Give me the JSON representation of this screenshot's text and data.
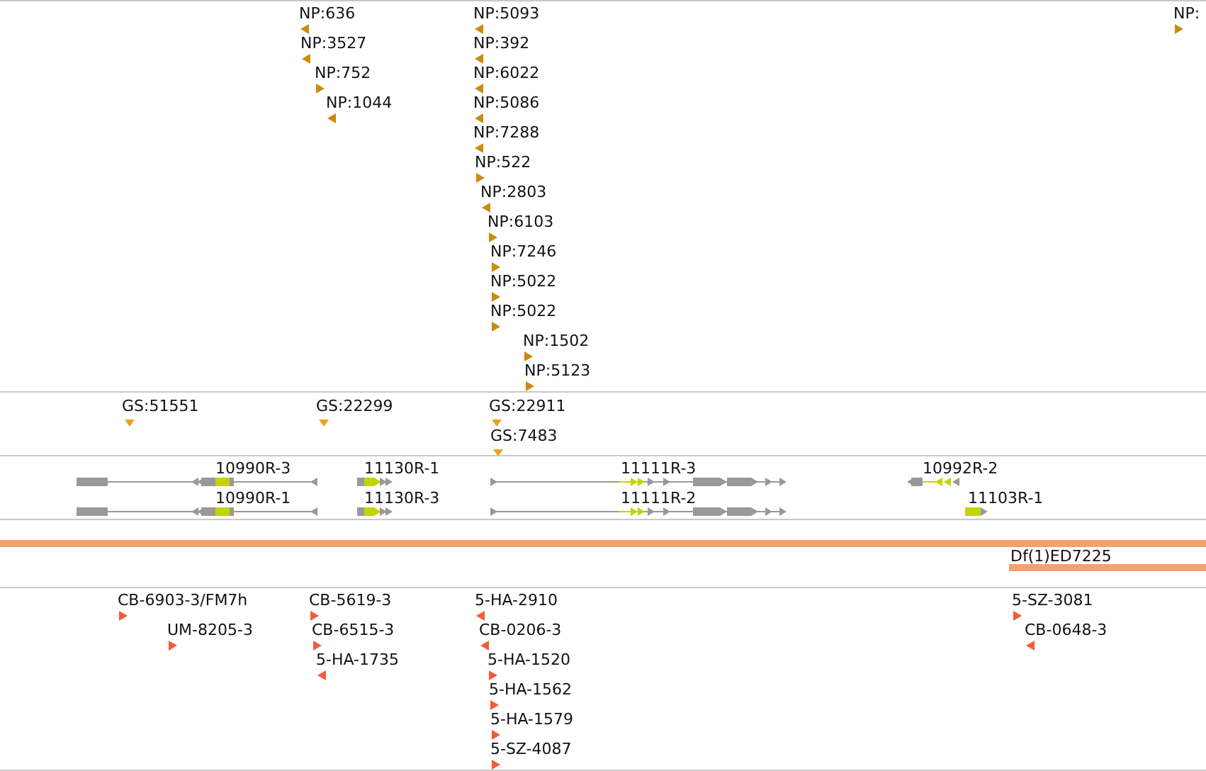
{
  "tracks": [
    {
      "kind": "markers",
      "color": "#cc8a0e",
      "features": [
        {
          "label": "NP:636",
          "reverse": true
        },
        {
          "label": "NP:3527",
          "reverse": true
        },
        {
          "label": "NP:752",
          "reverse": false
        },
        {
          "label": "NP:1044",
          "reverse": true
        },
        {
          "label": "NP:5093",
          "reverse": true
        },
        {
          "label": "NP:392",
          "reverse": true
        },
        {
          "label": "NP:6022",
          "reverse": true
        },
        {
          "label": "NP:5086",
          "reverse": true
        },
        {
          "label": "NP:7288",
          "reverse": true
        },
        {
          "label": "NP:522",
          "reverse": false
        },
        {
          "label": "NP:2803",
          "reverse": true
        },
        {
          "label": "NP:6103",
          "reverse": false
        },
        {
          "label": "NP:7246",
          "reverse": false
        },
        {
          "label": "NP:5022",
          "reverse": false
        },
        {
          "label": "NP:5022",
          "reverse": false
        },
        {
          "label": "NP:1502",
          "reverse": false
        },
        {
          "label": "NP:5123",
          "reverse": false
        },
        {
          "label": "NP:",
          "reverse": false
        }
      ]
    },
    {
      "kind": "sites",
      "color": "#f0a020",
      "features": [
        {
          "label": "GS:51551"
        },
        {
          "label": "GS:22299"
        },
        {
          "label": "GS:22911"
        },
        {
          "label": "GS:7483"
        }
      ]
    },
    {
      "kind": "genes",
      "transcripts": [
        {
          "label": "10990R-3"
        },
        {
          "label": "10990R-1"
        },
        {
          "label": "11130R-1"
        },
        {
          "label": "11130R-3"
        },
        {
          "label": "11111R-3"
        },
        {
          "label": "11111R-2"
        },
        {
          "label": "10992R-2"
        },
        {
          "label": "11103R-1"
        }
      ]
    },
    {
      "kind": "deficiencies",
      "color": "#f4a070",
      "features": [
        {
          "label": "Df(1)ED7225"
        }
      ]
    },
    {
      "kind": "markers",
      "color": "#f25c3a",
      "features": [
        {
          "label": "CB-6903-3/FM7h",
          "reverse": false
        },
        {
          "label": "UM-8205-3",
          "reverse": false
        },
        {
          "label": "CB-5619-3",
          "reverse": false
        },
        {
          "label": "CB-6515-3",
          "reverse": false
        },
        {
          "label": "5-HA-1735",
          "reverse": true
        },
        {
          "label": "5-HA-2910",
          "reverse": true
        },
        {
          "label": "CB-0206-3",
          "reverse": true
        },
        {
          "label": "5-HA-1520",
          "reverse": false
        },
        {
          "label": "5-HA-1562",
          "reverse": false
        },
        {
          "label": "5-HA-1579",
          "reverse": false
        },
        {
          "label": "5-SZ-4087",
          "reverse": false
        },
        {
          "label": "5-SZ-3081",
          "reverse": false
        },
        {
          "label": "CB-0648-3",
          "reverse": true
        }
      ]
    }
  ]
}
